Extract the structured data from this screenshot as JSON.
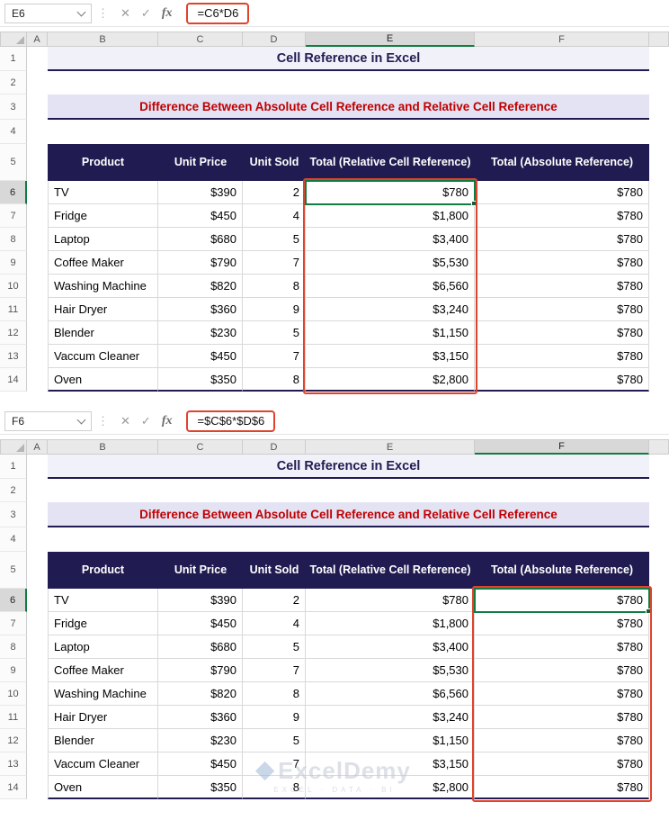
{
  "panels": [
    {
      "name_box": "E6",
      "formula": "=C6*D6",
      "active_col": "E",
      "active_row": 6
    },
    {
      "name_box": "F6",
      "formula": "=$C$6*$D$6",
      "active_col": "F",
      "active_row": 6
    }
  ],
  "columns": [
    "A",
    "B",
    "C",
    "D",
    "E",
    "F"
  ],
  "row_count": 14,
  "title": "Cell Reference in Excel",
  "subtitle": "Difference Between Absolute Cell Reference and Relative Cell Reference",
  "table": {
    "headers": [
      "Product",
      "Unit Price",
      "Unit Sold",
      "Total (Relative Cell Reference)",
      "Total (Absolute Reference)"
    ],
    "rows": [
      [
        "TV",
        "$390",
        "2",
        "$780",
        "$780"
      ],
      [
        "Fridge",
        "$450",
        "4",
        "$1,800",
        "$780"
      ],
      [
        "Laptop",
        "$680",
        "5",
        "$3,400",
        "$780"
      ],
      [
        "Coffee Maker",
        "$790",
        "7",
        "$5,530",
        "$780"
      ],
      [
        "Washing Machine",
        "$820",
        "8",
        "$6,560",
        "$780"
      ],
      [
        "Hair Dryer",
        "$360",
        "9",
        "$3,240",
        "$780"
      ],
      [
        "Blender",
        "$230",
        "5",
        "$1,150",
        "$780"
      ],
      [
        "Vaccum Cleaner",
        "$450",
        "7",
        "$3,150",
        "$780"
      ],
      [
        "Oven",
        "$350",
        "8",
        "$2,800",
        "$780"
      ]
    ]
  },
  "formula_bar": {
    "dots": "⋮",
    "cancel": "✕",
    "enter": "✓",
    "fx": "fx"
  },
  "watermark": {
    "brand": "ExcelDemy",
    "tagline": "EXCEL · DATA · BI"
  },
  "colors": {
    "navy": "#201C51",
    "red": "#C00000",
    "green": "#107C41",
    "annot": "#E0432C",
    "lavender": "#E3E3F3",
    "title_bg": "#F1F1FA"
  }
}
